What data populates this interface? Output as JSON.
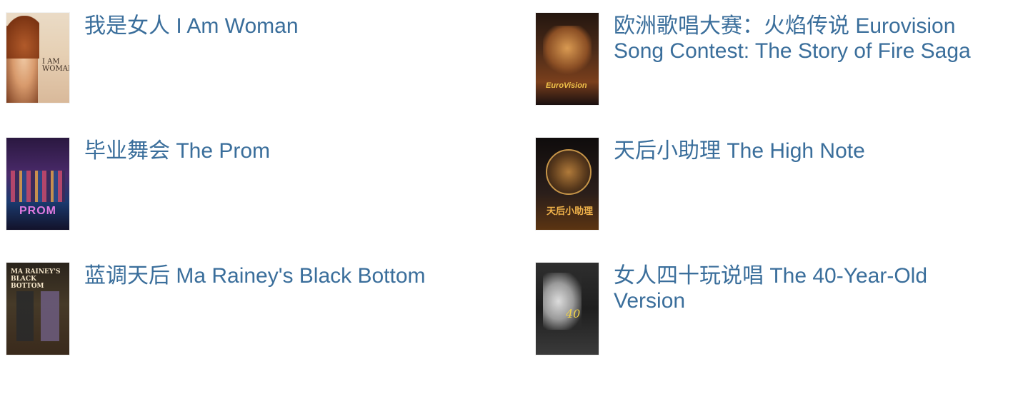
{
  "items": [
    {
      "title": "我是女人 I Am Woman",
      "poster_icon": "movie-poster-icon",
      "poster_text": "I AM WOMAN"
    },
    {
      "title": "欧洲歌唱大赛：火焰传说 Eurovision Song Contest: The Story of Fire Saga",
      "poster_icon": "movie-poster-icon",
      "poster_text": "EuroVision"
    },
    {
      "title": "毕业舞会 The Prom",
      "poster_icon": "movie-poster-icon",
      "poster_text": "PROM"
    },
    {
      "title": "天后小助理 The High Note",
      "poster_icon": "movie-poster-icon",
      "poster_text": "天后小助理"
    },
    {
      "title": "蓝调天后 Ma Rainey's Black Bottom",
      "poster_icon": "movie-poster-icon",
      "poster_text": "MA RAINEY'S BLACK BOTTOM"
    },
    {
      "title": "女人四十玩说唱 The 40-Year-Old Version",
      "poster_icon": "movie-poster-icon",
      "poster_text": "40"
    }
  ],
  "colors": {
    "link": "#3a6e9b",
    "background": "#ffffff"
  }
}
